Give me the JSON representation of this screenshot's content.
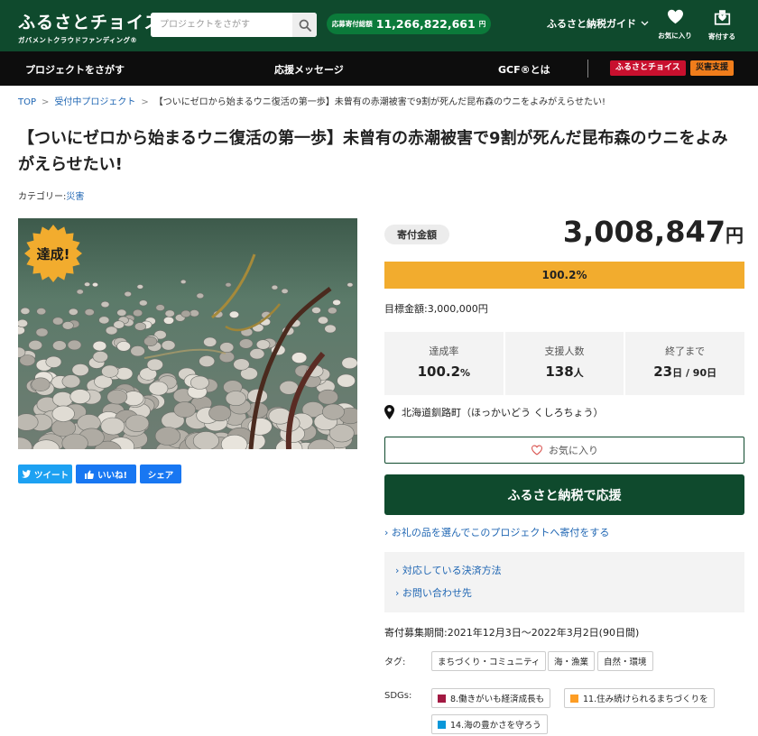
{
  "header": {
    "logo_main": "ふるさとチョイス",
    "logo_sub": "ガバメントクラウドファンディング®",
    "search_placeholder": "プロジェクトをさがす",
    "total_label": "応募寄付総額",
    "total_value": "11,266,822,661",
    "total_unit": "円",
    "guide_label": "ふるさと納税ガイド",
    "favorites_label": "お気に入り",
    "donate_label": "寄付する"
  },
  "nav": {
    "find": "プロジェクトをさがす",
    "messages": "応援メッセージ",
    "about": "GCF®とは",
    "badge_choice": "ふるさとチョイス",
    "badge_disaster": "災害支援"
  },
  "breadcrumb": {
    "top": "TOP",
    "active": "受付中プロジェクト",
    "current": "【ついにゼロから始まるウニ復活の第一歩】未曾有の赤潮被害で9割が死んだ昆布森のウニをよみがえらせたい!"
  },
  "project": {
    "title": "【ついにゼロから始まるウニ復活の第一歩】未曾有の赤潮被害で9割が死んだ昆布森のウニをよみがえらせたい!",
    "category_label": "カテゴリー:",
    "category": "災害",
    "achieved_badge": "達成!",
    "share_tweet": "ツイート",
    "share_like": "いいね!",
    "share_share": "シェア"
  },
  "funding": {
    "label": "寄付金額",
    "amount": "3,008,847",
    "amount_unit": "円",
    "progress_text": "100.2%",
    "progress_fraction": 1.0,
    "goal": "目標金額:3,000,000円",
    "stats": {
      "rate_label": "達成率",
      "rate_value": "100.2",
      "rate_unit": "%",
      "supporters_label": "支援人数",
      "supporters_value": "138",
      "supporters_unit": "人",
      "remaining_label": "終了まで",
      "remaining_value": "23",
      "remaining_unit": "日",
      "remaining_total": "90日"
    },
    "location": "北海道釧路町（ほっかいどう くしろちょう）",
    "favorite_button": "お気に入り",
    "cta_button": "ふるさと納税で応援",
    "gift_link": "お礼の品を選んでこのプロジェクトへ寄付をする",
    "payment_link": "対応している決済方法",
    "contact_link": "お問い合わせ先",
    "period": "寄付募集期間:2021年12月3日〜2022年3月2日(90日間)"
  },
  "tags": {
    "label": "タグ:",
    "items": [
      "まちづくり・コミュニティ",
      "海・漁業",
      "自然・環境"
    ]
  },
  "sdgs": {
    "label": "SDGs:",
    "items": [
      "8.働きがいも経済成長も",
      "11.住み続けられるまちづくりを",
      "14.海の豊かさを守ろう"
    ],
    "colors": [
      "#a21942",
      "#fd9d24",
      "#0a97d9"
    ]
  },
  "colors": {
    "brand_green": "#0f4a2d",
    "total_green": "#0b7a3a",
    "progress": "#f2ac2e",
    "link": "#1f66b3",
    "badge_red": "#c8102e",
    "badge_orange": "#f07d1b"
  }
}
